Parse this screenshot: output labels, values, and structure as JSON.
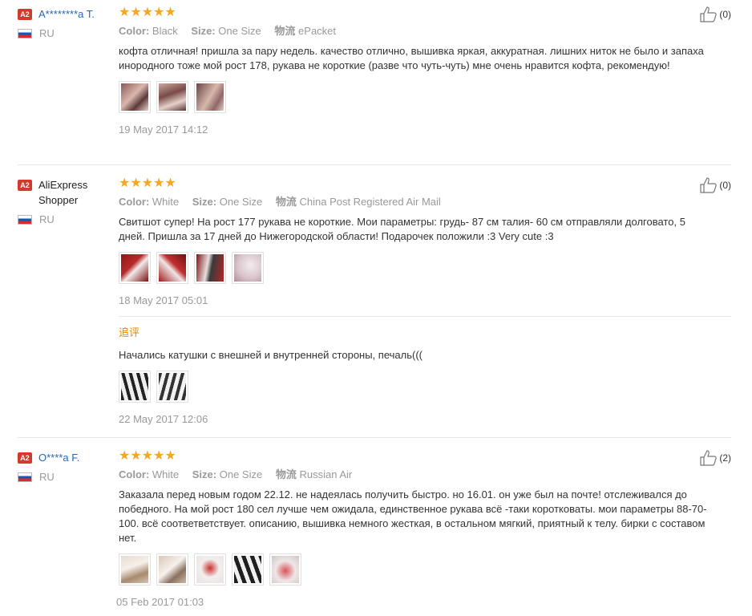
{
  "labels": {
    "color": "Color:",
    "size": "Size:",
    "shipping": "物流"
  },
  "reviews": [
    {
      "badge": "A2",
      "name": "A********a T.",
      "country": "RU",
      "stars": "★★★★★",
      "color": "Black",
      "size": "One Size",
      "shipping": "ePacket",
      "text": "кофта отличная! пришла за пару недель. качество отлично, вышивка яркая, аккуратная. лишних ниток не было и запаха инородного тоже мой рост 178, рукава не короткие (разве что чуть-чуть) мне очень нравится кофта, рекомендую!",
      "date": "19 May 2017 14:12",
      "helpful": "(0)"
    },
    {
      "badge": "A2",
      "name": "AliExpress Shopper",
      "country": "RU",
      "stars": "★★★★★",
      "color": "White",
      "size": "One Size",
      "shipping": "China Post Registered Air Mail",
      "text": "Свитшот супер! На рост 177 рукава не короткие. Мои параметры: грудь- 87 см талия- 60 см отправляли долговато, 5 дней. Пришла за 17 дней до Нижегородской области! Подарочек положили :3 Very cute :3",
      "date": "18 May 2017 05:01",
      "helpful": "(0)",
      "additional_label": "追评",
      "additional_text": "Начались катушки с внешней и внутренней стороны, печаль(((",
      "additional_date": "22 May 2017 12:06"
    },
    {
      "badge": "A2",
      "name": "O****a F.",
      "country": "RU",
      "stars": "★★★★★",
      "color": "White",
      "size": "One Size",
      "shipping": "Russian Air",
      "text": "Заказала перед новым годом 22.12. не надеялась получить быстро. но 16.01. он уже был на почте! отслеживался до победного. На мой рост 180 сел лучше чем ожидала, единственное рукава всё -таки коротковаты. мои параметры 88-70-100. всё соответветствует. описанию, вышивка немного жесткая, в остальном мягкий, приятный к телу. бирки с составом нет.",
      "date": "05 Feb 2017 01:03",
      "helpful": "(2)"
    }
  ],
  "colors": {
    "link": "#2468b8",
    "star": "#f5a623",
    "badge": "#d23a2e",
    "additional": "#f08200"
  }
}
